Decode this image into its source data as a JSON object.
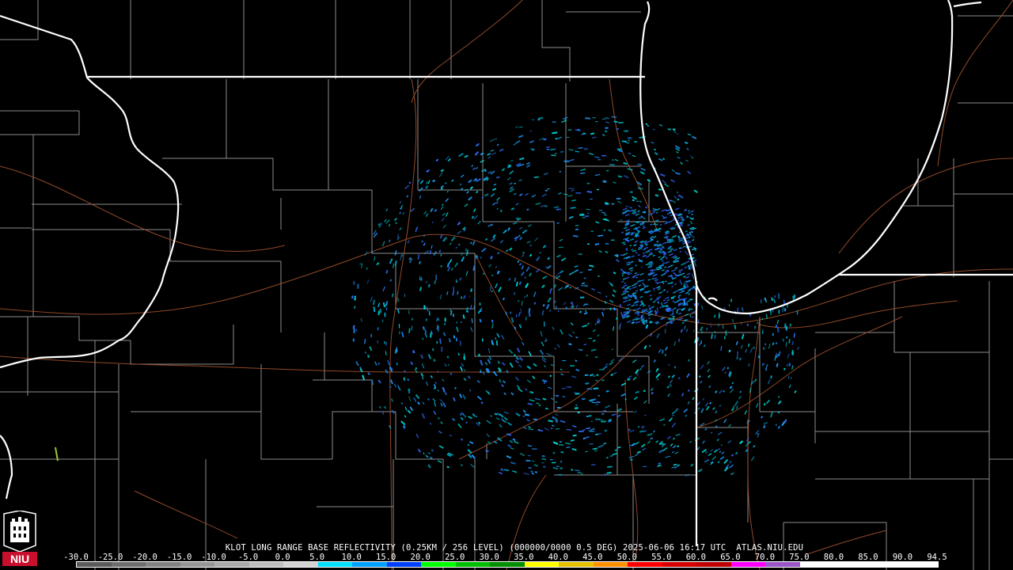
{
  "product": {
    "title": "KLOT LONG RANGE BASE REFLECTIVITY (0.25KM / 256 LEVEL) (000000/0000 0.5 DEG) 2025-06-06 16:17 UTC  ATLAS.NIU.EDU"
  },
  "scale": {
    "labels": [
      "-30.0",
      "-25.0",
      "-20.0",
      "-15.0",
      "-10.0",
      "-5.0",
      "0.0",
      "5.0",
      "10.0",
      "15.0",
      "20.0",
      "25.0",
      "30.0",
      "35.0",
      "40.0",
      "45.0",
      "50.0",
      "55.0",
      "60.0",
      "65.0",
      "70.0",
      "75.0",
      "80.0",
      "85.0",
      "90.0",
      "94.5"
    ],
    "colors": [
      "#5a5a5a",
      "#6e6e6e",
      "#828282",
      "#969696",
      "#aaaaaa",
      "#bebebe",
      "#d2d2d2",
      "#00e0ff",
      "#00a0ff",
      "#0040ff",
      "#00ff00",
      "#00c000",
      "#009000",
      "#ffff00",
      "#e7c000",
      "#ff9000",
      "#ff0000",
      "#d60000",
      "#c00000",
      "#ff00ff",
      "#9955c9",
      "#ffffff",
      "#ffffff",
      "#ffffff",
      "#ffffff"
    ]
  },
  "logo": {
    "text": "NIU",
    "colors": {
      "red": "#c8102e",
      "white": "#ffffff"
    }
  }
}
